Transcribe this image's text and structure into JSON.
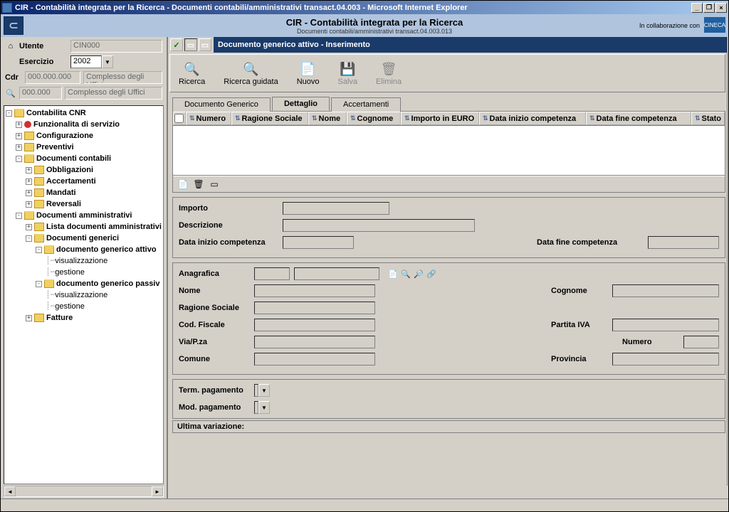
{
  "window": {
    "title": "CIR - Contabilità integrata per la Ricerca - Documenti contabili/amministrativi transact.04.003 - Microsoft Internet Explorer"
  },
  "appHeader": {
    "title": "CIR - Contabilità integrata per la Ricerca",
    "subtitle": "Documenti contabili/amministrativi transact.04.003.013",
    "collab": "In collaborazione con",
    "logo": "CINECA"
  },
  "leftTop": {
    "userLabel": "Utente",
    "userValue": "CIN000",
    "exerciseLabel": "Esercizio",
    "exerciseValue": "2002",
    "cdrLabel": "Cdr",
    "cdrCode": "000.000.000",
    "cdrDesc": "Complesso degli Uffici",
    "uoCode": "000.000",
    "uoDesc": "Complesso degli Uffici"
  },
  "tree": {
    "root": "Contabilita CNR",
    "n1": "Funzionalita di servizio",
    "n2": "Configurazione",
    "n3": "Preventivi",
    "n4": "Documenti contabili",
    "n4a": "Obbligazioni",
    "n4b": "Accertamenti",
    "n4c": "Mandati",
    "n4d": "Reversali",
    "n5": "Documenti amministrativi",
    "n5a": "Lista documenti amministrativi",
    "n5b": "Documenti generici",
    "n5b1": "documento generico attivo",
    "n5b1a": "visualizzazione",
    "n5b1b": "gestione",
    "n5b2": "documento generico passiv",
    "n5b2a": "visualizzazione",
    "n5b2b": "gestione",
    "n5c": "Fatture"
  },
  "docHeader": "Documento generico attivo - Inserimento",
  "toolbar": {
    "ricerca": "Ricerca",
    "ricercaGuidata": "Ricerca guidata",
    "nuovo": "Nuovo",
    "salva": "Salva",
    "elimina": "Elimina"
  },
  "tabs": {
    "t1": "Documento Generico",
    "t2": "Dettaglio",
    "t3": "Accertamenti"
  },
  "gridHeaders": {
    "numero": "Numero",
    "ragione": "Ragione Sociale",
    "nome": "Nome",
    "cognome": "Cognome",
    "importo": "Importo in EURO",
    "dataInizio": "Data inizio competenza",
    "dataFine": "Data fine competenza",
    "stato": "Stato"
  },
  "form": {
    "importo": "Importo",
    "descrizione": "Descrizione",
    "dataInizioComp": "Data inizio competenza",
    "dataFineComp": "Data fine competenza",
    "anagrafica": "Anagrafica",
    "nome": "Nome",
    "cognome": "Cognome",
    "ragioneSociale": "Ragione Sociale",
    "codFiscale": "Cod. Fiscale",
    "partitaIva": "Partita IVA",
    "viaPza": "Via/P.za",
    "numero": "Numero",
    "comune": "Comune",
    "provincia": "Provincia",
    "termPagamento": "Term. pagamento",
    "modPagamento": "Mod. pagamento"
  },
  "status": "Ultima variazione:"
}
